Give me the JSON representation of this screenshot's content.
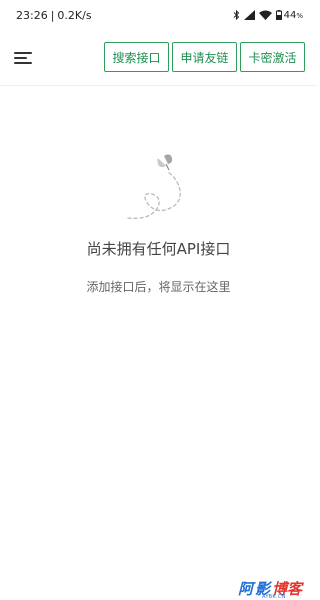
{
  "status_bar": {
    "time": "23:26",
    "separator": "|",
    "speed": "0.2K/s",
    "battery": "44",
    "battery_unit": "%"
  },
  "toolbar": {
    "search_api_label": "搜索接口",
    "apply_friend_link_label": "申请友链",
    "card_activate_label": "卡密激活"
  },
  "empty_state": {
    "title": "尚未拥有任何API接口",
    "subtitle": "添加接口后，将显示在这里"
  },
  "watermark": {
    "text_a": "阿",
    "text_b": "影",
    "text_c": "博客",
    "small": "AYBK.CN"
  },
  "colors": {
    "accent": "#2e9d5e",
    "watermark_blue": "#1f6fd6",
    "watermark_red": "#e5352e"
  }
}
